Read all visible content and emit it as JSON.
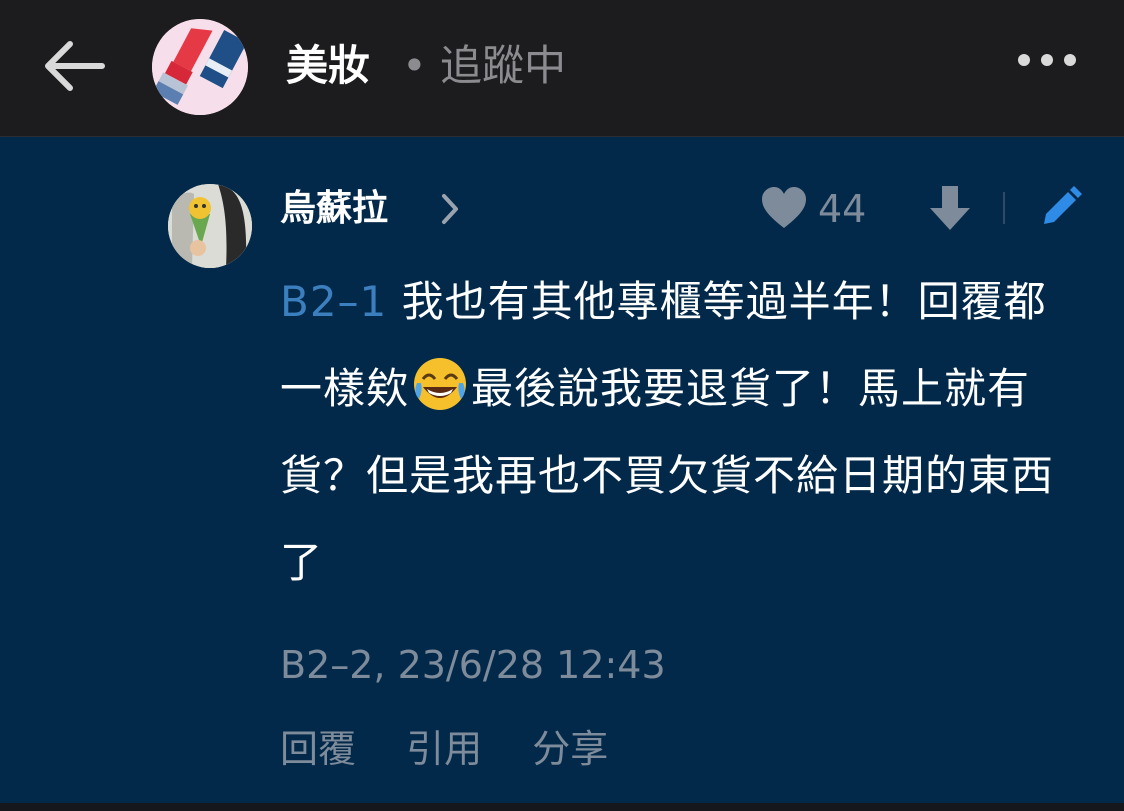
{
  "header": {
    "back_icon": "arrow-left-icon",
    "board_name": "美妝",
    "separator": "•",
    "follow_status": "追蹤中",
    "more_icon": "more-horizontal-icon"
  },
  "comment": {
    "author": "烏蘇拉",
    "like_count": "44",
    "reply_ref": "B2–1",
    "text_part1": " 我也有其他專櫃等過半年！回覆都一樣欸",
    "emoji_name": "laughing-crying-emoji",
    "text_part2": "最後說我要退貨了！馬上就有貨？但是我再也不買欠貨不給日期的東西了",
    "meta": "B2–2, 23/6/28 12:43",
    "actions": {
      "reply": "回覆",
      "quote": "引用",
      "share": "分享"
    }
  },
  "colors": {
    "header_bg": "#1c1c1e",
    "comment_bg": "#03294a",
    "accent_link": "#3c7fbe",
    "muted_text": "#7d8b9a"
  }
}
